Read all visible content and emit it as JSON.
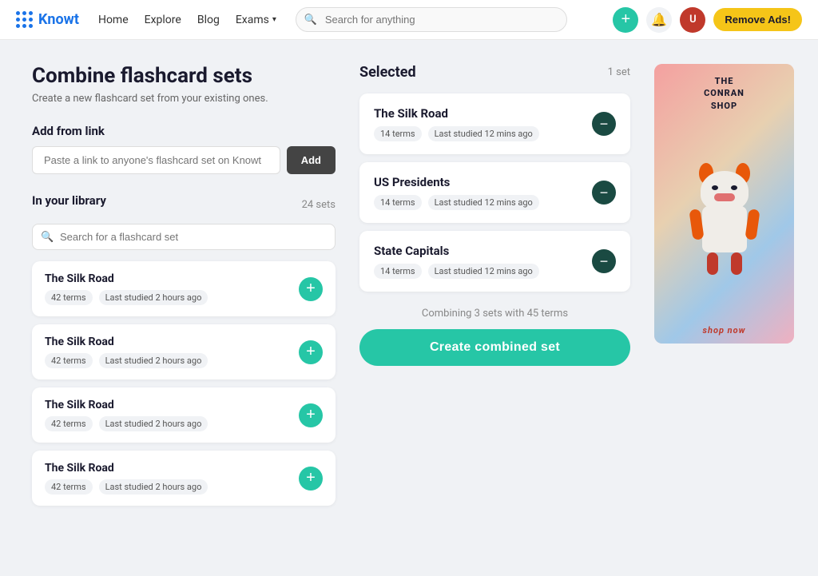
{
  "navbar": {
    "logo_text": "Knowt",
    "links": [
      {
        "label": "Home",
        "id": "home"
      },
      {
        "label": "Explore",
        "id": "explore"
      },
      {
        "label": "Blog",
        "id": "blog"
      },
      {
        "label": "Exams",
        "id": "exams",
        "dropdown": true
      }
    ],
    "search_placeholder": "Search for anything",
    "remove_ads_label": "Remove Ads!"
  },
  "page": {
    "title": "Combine flashcard sets",
    "subtitle": "Create a new flashcard set from your existing ones."
  },
  "add_from_link": {
    "section_label": "Add from link",
    "input_placeholder": "Paste a link to anyone's flashcard set on Knowt",
    "btn_label": "Add"
  },
  "library": {
    "section_label": "In your library",
    "count": "24 sets",
    "search_placeholder": "Search for a flashcard set",
    "items": [
      {
        "title": "The Silk Road",
        "terms": "42 terms",
        "last_studied": "Last studied 2 hours ago"
      },
      {
        "title": "The Silk Road",
        "terms": "42 terms",
        "last_studied": "Last studied 2 hours ago"
      },
      {
        "title": "The Silk Road",
        "terms": "42 terms",
        "last_studied": "Last studied 2 hours ago"
      },
      {
        "title": "The Silk Road",
        "terms": "42 terms",
        "last_studied": "Last studied 2 hours ago"
      }
    ]
  },
  "selected": {
    "section_label": "Selected",
    "count": "1 set",
    "items": [
      {
        "title": "The Silk Road",
        "terms": "14 terms",
        "last_studied": "Last studied 12 mins ago"
      },
      {
        "title": "US Presidents",
        "terms": "14 terms",
        "last_studied": "Last studied 12 mins ago"
      },
      {
        "title": "State Capitals",
        "terms": "14 terms",
        "last_studied": "Last studied 12 mins ago"
      }
    ],
    "combine_info": "Combining 3 sets with 45 terms",
    "create_btn_label": "Create combined set"
  },
  "ad": {
    "title": "THE\nCONRAN\nSHOP",
    "shop_now": "shop now"
  }
}
